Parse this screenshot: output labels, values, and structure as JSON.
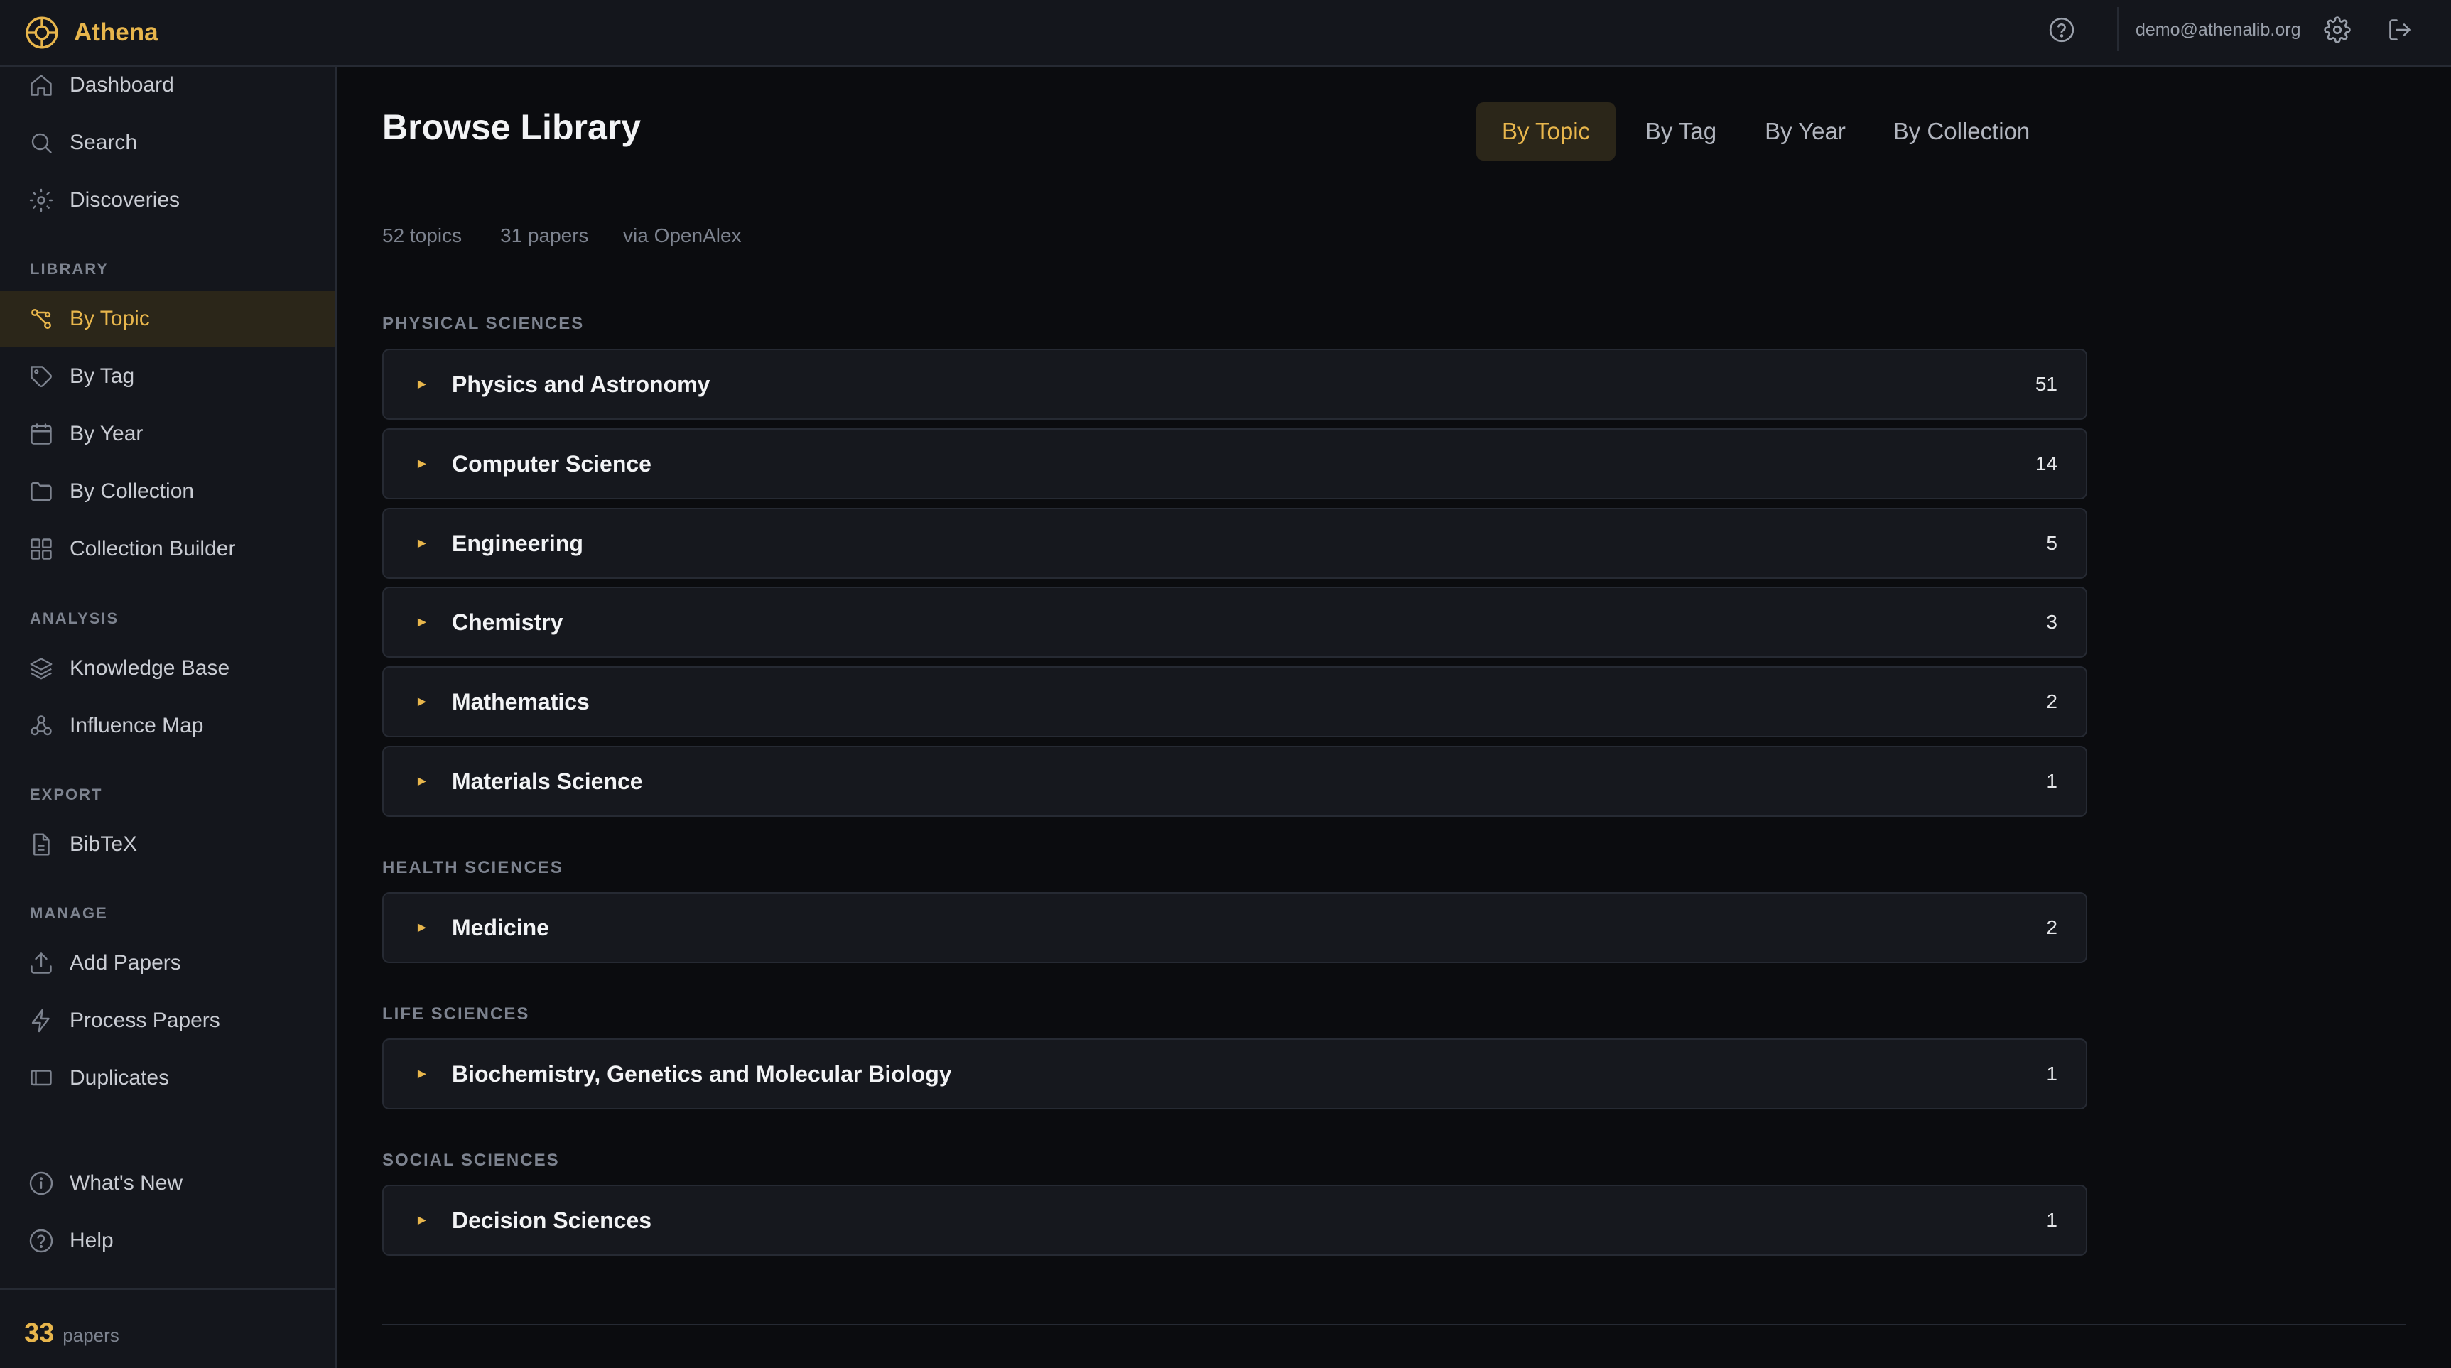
{
  "app": {
    "brand": "Athena",
    "brand_color": "#e8b64c",
    "user_email": "demo@athenalib.org"
  },
  "sidebar": {
    "top_items": [
      {
        "label": "Dashboard",
        "icon": "home-icon"
      },
      {
        "label": "Search",
        "icon": "search-icon"
      },
      {
        "label": "Discoveries",
        "icon": "sparkle-icon"
      }
    ],
    "sections": [
      {
        "label": "LIBRARY",
        "items": [
          {
            "label": "By Topic",
            "icon": "topic-icon",
            "active": true
          },
          {
            "label": "By Tag",
            "icon": "tag-icon"
          },
          {
            "label": "By Year",
            "icon": "calendar-icon"
          },
          {
            "label": "By Collection",
            "icon": "folder-icon"
          },
          {
            "label": "Collection Builder",
            "icon": "grid-icon"
          }
        ]
      },
      {
        "label": "ANALYSIS",
        "items": [
          {
            "label": "Knowledge Base",
            "icon": "layers-icon"
          },
          {
            "label": "Influence Map",
            "icon": "network-icon"
          }
        ]
      },
      {
        "label": "EXPORT",
        "items": [
          {
            "label": "BibTeX",
            "icon": "file-icon"
          }
        ]
      },
      {
        "label": "MANAGE",
        "items": [
          {
            "label": "Add Papers",
            "icon": "upload-icon"
          },
          {
            "label": "Process Papers",
            "icon": "bolt-icon"
          },
          {
            "label": "Duplicates",
            "icon": "duplicate-icon"
          }
        ]
      }
    ],
    "bottom_items": [
      {
        "label": "What's New",
        "icon": "info-icon"
      },
      {
        "label": "Help",
        "icon": "help-icon"
      }
    ],
    "footer": {
      "count": "33",
      "label": "papers"
    }
  },
  "main": {
    "title": "Browse Library",
    "tabs": [
      {
        "label": "By Topic",
        "active": true
      },
      {
        "label": "By Tag"
      },
      {
        "label": "By Year"
      },
      {
        "label": "By Collection"
      }
    ],
    "meta": {
      "topics": "52 topics",
      "papers": "31 papers",
      "source": "via OpenAlex"
    },
    "groups": [
      {
        "label": "PHYSICAL SCIENCES",
        "topics": [
          {
            "name": "Physics and Astronomy",
            "count": "51"
          },
          {
            "name": "Computer Science",
            "count": "14"
          },
          {
            "name": "Engineering",
            "count": "5"
          },
          {
            "name": "Chemistry",
            "count": "3"
          },
          {
            "name": "Mathematics",
            "count": "2"
          },
          {
            "name": "Materials Science",
            "count": "1"
          }
        ]
      },
      {
        "label": "HEALTH SCIENCES",
        "topics": [
          {
            "name": "Medicine",
            "count": "2"
          }
        ]
      },
      {
        "label": "LIFE SCIENCES",
        "topics": [
          {
            "name": "Biochemistry, Genetics and Molecular Biology",
            "count": "1"
          }
        ]
      },
      {
        "label": "SOCIAL SCIENCES",
        "topics": [
          {
            "name": "Decision Sciences",
            "count": "1"
          }
        ]
      }
    ]
  }
}
